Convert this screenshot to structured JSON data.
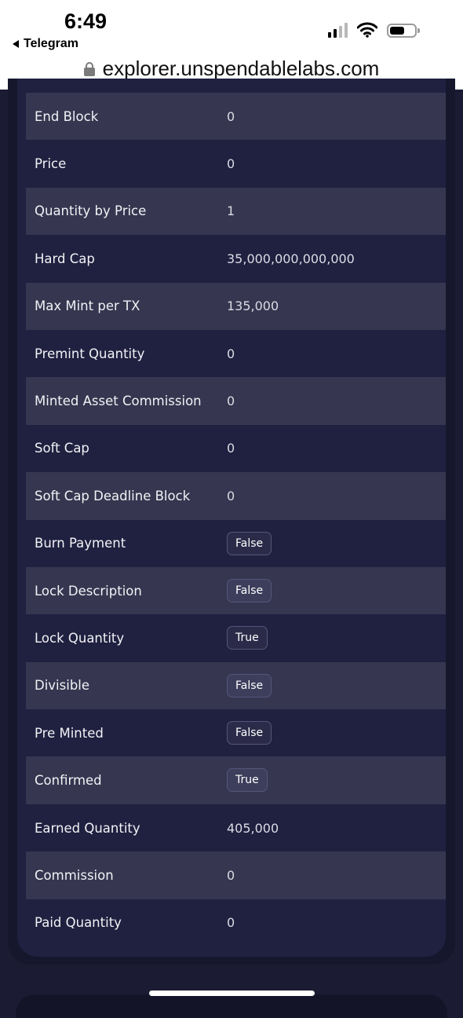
{
  "status_bar": {
    "time": "6:49",
    "back_app": "Telegram",
    "url": "explorer.unspendablelabs.com"
  },
  "rows": [
    {
      "label": "End Block",
      "value": "0"
    },
    {
      "label": "Price",
      "value": "0"
    },
    {
      "label": "Quantity by Price",
      "value": "1"
    },
    {
      "label": "Hard Cap",
      "value": "35,000,000,000,000"
    },
    {
      "label": "Max Mint per TX",
      "value": "135,000"
    },
    {
      "label": "Premint Quantity",
      "value": "0"
    },
    {
      "label": "Minted Asset Commission",
      "value": "0"
    },
    {
      "label": "Soft Cap",
      "value": "0"
    },
    {
      "label": "Soft Cap Deadline Block",
      "value": "0"
    },
    {
      "label": "Burn Payment",
      "badge": "False"
    },
    {
      "label": "Lock Description",
      "badge": "False"
    },
    {
      "label": "Lock Quantity",
      "badge": "True"
    },
    {
      "label": "Divisible",
      "badge": "False"
    },
    {
      "label": "Pre Minted",
      "badge": "False"
    },
    {
      "label": "Confirmed",
      "badge": "True"
    },
    {
      "label": "Earned Quantity",
      "value": "405,000"
    },
    {
      "label": "Commission",
      "value": "0"
    },
    {
      "label": "Paid Quantity",
      "value": "0"
    }
  ]
}
